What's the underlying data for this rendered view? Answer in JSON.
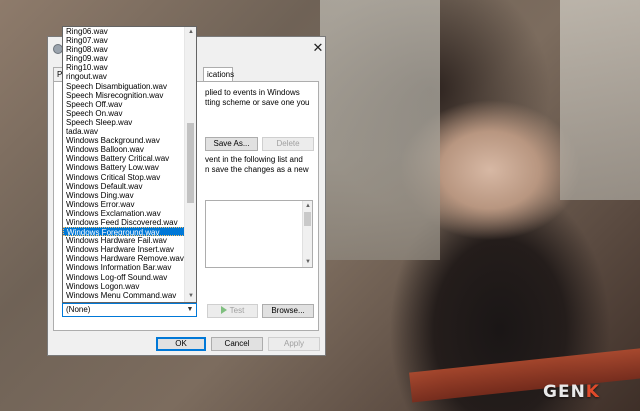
{
  "dialog": {
    "close_glyph": "✕",
    "tabs": [
      {
        "label": "Pl"
      },
      {
        "label": "ications"
      }
    ],
    "description_top": [
      "plied to events in Windows",
      "tting scheme or save one you"
    ],
    "description_events": [
      "vent in the following list and",
      "n save the changes as a new"
    ],
    "save_as_label": "Save As...",
    "delete_label": "Delete",
    "test_label": "Test",
    "browse_label": "Browse...",
    "ok_label": "OK",
    "cancel_label": "Cancel",
    "apply_label": "Apply"
  },
  "sound_list": {
    "items": [
      "Ring06.wav",
      "Ring07.wav",
      "Ring08.wav",
      "Ring09.wav",
      "Ring10.wav",
      "ringout.wav",
      "Speech Disambiguation.wav",
      "Speech Misrecognition.wav",
      "Speech Off.wav",
      "Speech On.wav",
      "Speech Sleep.wav",
      "tada.wav",
      "Windows Background.wav",
      "Windows Balloon.wav",
      "Windows Battery Critical.wav",
      "Windows Battery Low.wav",
      "Windows Critical Stop.wav",
      "Windows Default.wav",
      "Windows Ding.wav",
      "Windows Error.wav",
      "Windows Exclamation.wav",
      "Windows Feed Discovered.wav",
      "Windows Foreground.wav",
      "Windows Hardware Fail.wav",
      "Windows Hardware Insert.wav",
      "Windows Hardware Remove.wav",
      "Windows Information Bar.wav",
      "Windows Log-off Sound.wav",
      "Windows Logon.wav",
      "Windows Menu Command.wav"
    ],
    "selected_item": "Windows Foreground.wav"
  },
  "combo": {
    "value": "(None)"
  },
  "watermark": {
    "prefix": "GEN",
    "suffix": "K"
  },
  "colors": {
    "selection": "#0078d7",
    "accent_focus": "#f5c16b"
  }
}
